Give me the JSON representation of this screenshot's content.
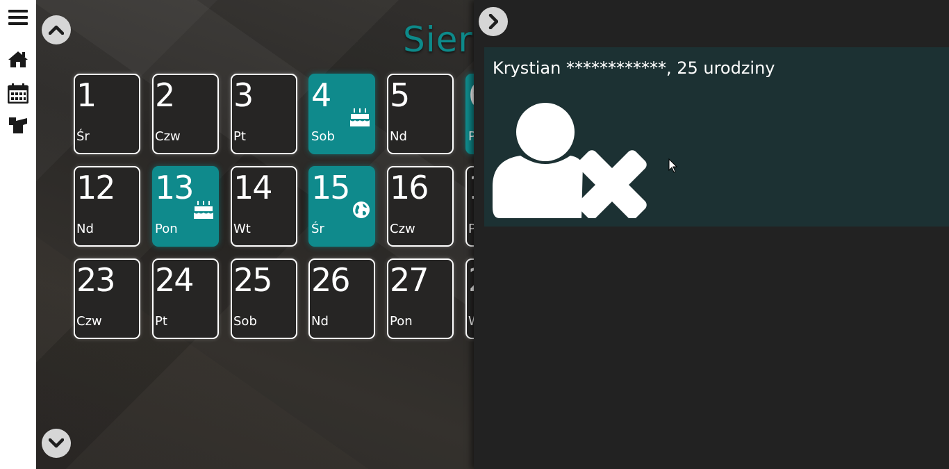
{
  "sidebar": {
    "items": [
      {
        "icon": "menu-icon"
      },
      {
        "icon": "home-icon"
      },
      {
        "icon": "calendar-icon"
      },
      {
        "icon": "chess-rook-icon"
      }
    ]
  },
  "calendar": {
    "month_title": "Sier",
    "rows": [
      [
        {
          "num": "1",
          "day": "Śr",
          "event": false
        },
        {
          "num": "2",
          "day": "Czw",
          "event": false
        },
        {
          "num": "3",
          "day": "Pt",
          "event": false
        },
        {
          "num": "4",
          "day": "Sob",
          "event": true,
          "icon": "birthday-cake-icon"
        },
        {
          "num": "5",
          "day": "Nd",
          "event": false
        },
        {
          "num": "6",
          "day": "P",
          "event": true
        }
      ],
      [
        {
          "num": "12",
          "day": "Nd",
          "event": false
        },
        {
          "num": "13",
          "day": "Pon",
          "event": true,
          "icon": "birthday-cake-icon"
        },
        {
          "num": "14",
          "day": "Wt",
          "event": false
        },
        {
          "num": "15",
          "day": "Śr",
          "event": true,
          "icon": "globe-icon"
        },
        {
          "num": "16",
          "day": "Czw",
          "event": false
        },
        {
          "num": "1",
          "day": "P",
          "event": false
        }
      ],
      [
        {
          "num": "23",
          "day": "Czw",
          "event": false
        },
        {
          "num": "24",
          "day": "Pt",
          "event": false
        },
        {
          "num": "25",
          "day": "Sob",
          "event": false
        },
        {
          "num": "26",
          "day": "Nd",
          "event": false
        },
        {
          "num": "27",
          "day": "Pon",
          "event": false
        },
        {
          "num": "2",
          "day": "W",
          "event": false
        }
      ]
    ]
  },
  "detail": {
    "event_title": "Krystian ************, 25 urodziny",
    "image_icon": "user-remove-icon"
  },
  "colors": {
    "accent": "#0f8a8c",
    "title": "#0d8a8a",
    "card": "#1c3133",
    "panel": "#222222"
  }
}
